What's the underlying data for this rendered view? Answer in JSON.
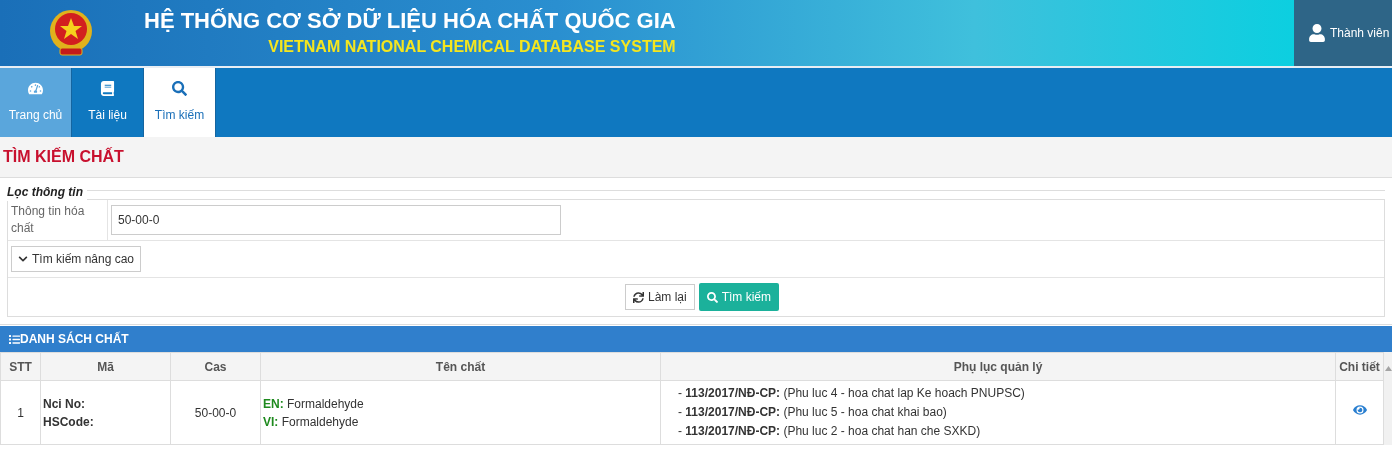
{
  "header": {
    "title": "HỆ THỐNG CƠ SỞ DỮ LIỆU HÓA CHẤT QUỐC GIA",
    "subtitle": "VIETNAM NATIONAL CHEMICAL DATABASE SYSTEM",
    "user": "Thành viên"
  },
  "tabs": [
    {
      "label": "Trang chủ",
      "selected": false,
      "highlighted": true
    },
    {
      "label": "Tài liệu",
      "selected": false,
      "highlighted": false
    },
    {
      "label": "Tìm kiếm",
      "selected": true,
      "highlighted": false
    }
  ],
  "page_title": "TÌM KIẾM CHẤT",
  "filter": {
    "legend": "Lọc thông tin",
    "field_label": "Thông tin hóa chất",
    "field_value": "50-00-0",
    "advanced": "Tìm kiếm nâng cao",
    "reset": "Làm lại",
    "search": "Tìm kiếm"
  },
  "list": {
    "title": "DANH SÁCH CHẤT",
    "columns": [
      "STT",
      "Mã",
      "Cas",
      "Tên chất",
      "Phụ lục quản lý",
      "Chi tiết"
    ],
    "rows": [
      {
        "stt": "1",
        "codes": [
          "Nci No:",
          "HSCode:"
        ],
        "cas": "50-00-0",
        "names": [
          {
            "lang": "EN:",
            "name": "Formaldehyde"
          },
          {
            "lang": "VI:",
            "name": "Formaldehyde"
          }
        ],
        "annexes": [
          "- **113/2017/NĐ-CP:** (Phu luc 4 - hoa chat lap Ke hoach PNUPSC)",
          "- **113/2017/NĐ-CP:** (Phu luc 5 - hoa chat khai bao)",
          "- **113/2017/NĐ-CP:** (Phu luc 2 - hoa chat han che SXKD)"
        ]
      }
    ]
  }
}
